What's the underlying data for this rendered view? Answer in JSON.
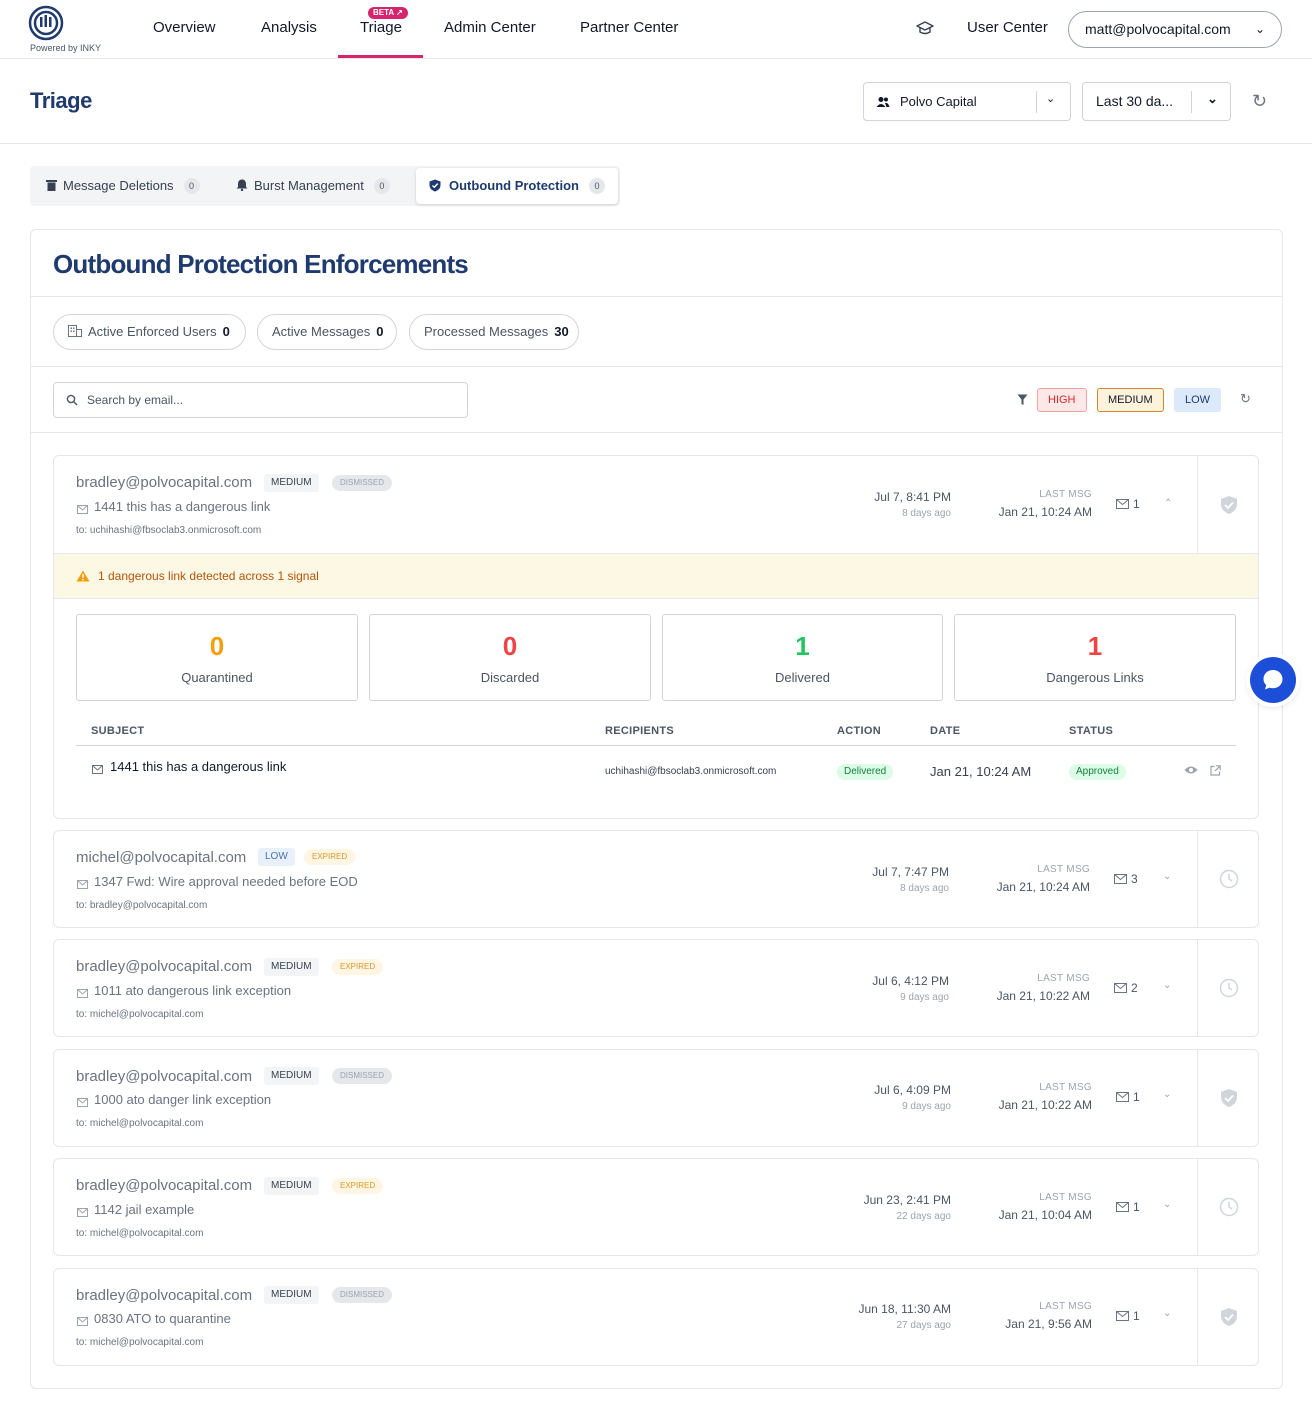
{
  "brand": {
    "powered_by": "Powered by INKY"
  },
  "nav": {
    "items": [
      "Overview",
      "Analysis",
      "Triage",
      "Admin Center",
      "Partner Center"
    ],
    "beta_label": "BETA ↗",
    "user_center": "User Center",
    "account_email": "matt@polvocapital.com"
  },
  "header": {
    "title": "Triage",
    "org_select": "Polvo Capital",
    "range_select": "Last 30 da..."
  },
  "tabs": [
    {
      "label": "Message Deletions",
      "count": "0"
    },
    {
      "label": "Burst Management",
      "count": "0"
    },
    {
      "label": "Outbound Protection",
      "count": "0"
    }
  ],
  "main": {
    "title": "Outbound Protection Enforcements",
    "pills": [
      {
        "label": "Active Enforced Users",
        "value": "0"
      },
      {
        "label": "Active Messages",
        "value": "0"
      },
      {
        "label": "Processed Messages",
        "value": "30"
      }
    ],
    "search_placeholder": "Search by email...",
    "severity_filters": [
      "HIGH",
      "MEDIUM",
      "LOW"
    ]
  },
  "rows": [
    {
      "sender": "bradley@polvocapital.com",
      "severity": "MEDIUM",
      "status": "DISMISSED",
      "subject": "1441 this has a dangerous link",
      "to": "to: uchihashi@fbsoclab3.onmicrosoft.com",
      "date": "Jul 7, 8:41 PM",
      "ago": "8 days ago",
      "last_label": "LAST MSG",
      "last": "Jan 21, 10:24 AM",
      "count": "1"
    },
    {
      "sender": "michel@polvocapital.com",
      "severity": "LOW",
      "status": "EXPIRED",
      "subject": "1347 Fwd: Wire approval needed before EOD",
      "to": "to: bradley@polvocapital.com",
      "date": "Jul 7, 7:47 PM",
      "ago": "8 days ago",
      "last_label": "LAST MSG",
      "last": "Jan 21, 10:24 AM",
      "count": "3"
    },
    {
      "sender": "bradley@polvocapital.com",
      "severity": "MEDIUM",
      "status": "EXPIRED",
      "subject": "1011 ato dangerous link exception",
      "to": "to: michel@polvocapital.com",
      "date": "Jul 6, 4:12 PM",
      "ago": "9 days ago",
      "last_label": "LAST MSG",
      "last": "Jan 21, 10:22 AM",
      "count": "2"
    },
    {
      "sender": "bradley@polvocapital.com",
      "severity": "MEDIUM",
      "status": "DISMISSED",
      "subject": "1000 ato danger link exception",
      "to": "to: michel@polvocapital.com",
      "date": "Jul 6, 4:09 PM",
      "ago": "9 days ago",
      "last_label": "LAST MSG",
      "last": "Jan 21, 10:22 AM",
      "count": "1"
    },
    {
      "sender": "bradley@polvocapital.com",
      "severity": "MEDIUM",
      "status": "EXPIRED",
      "subject": "1142 jail example",
      "to": "to: michel@polvocapital.com",
      "date": "Jun 23, 2:41 PM",
      "ago": "22 days ago",
      "last_label": "LAST MSG",
      "last": "Jan 21, 10:04 AM",
      "count": "1"
    },
    {
      "sender": "bradley@polvocapital.com",
      "severity": "MEDIUM",
      "status": "DISMISSED",
      "subject": "0830 ATO to quarantine",
      "to": "to: michel@polvocapital.com",
      "date": "Jun 18, 11:30 AM",
      "ago": "27 days ago",
      "last_label": "LAST MSG",
      "last": "Jan 21, 9:56 AM",
      "count": "1"
    }
  ],
  "expanded": {
    "alert": "1 dangerous link detected across 1 signal",
    "stats": [
      {
        "value": "0",
        "label": "Quarantined",
        "color": "#f59e0b"
      },
      {
        "value": "0",
        "label": "Discarded",
        "color": "#ef4444"
      },
      {
        "value": "1",
        "label": "Delivered",
        "color": "#22c55e"
      },
      {
        "value": "1",
        "label": "Dangerous Links",
        "color": "#ef4444"
      }
    ],
    "table_headers": [
      "SUBJECT",
      "RECIPIENTS",
      "ACTION",
      "DATE",
      "STATUS"
    ],
    "message": {
      "subject": "1441 this has a dangerous link",
      "recipient": "uchihashi@fbsoclab3.onmicrosoft.com",
      "action": "Delivered",
      "date": "Jan 21, 10:24 AM",
      "status": "Approved"
    }
  },
  "colors": {
    "accent": "#d6246e",
    "title": "#1e3a6e",
    "chat": "#1d4ed8"
  }
}
